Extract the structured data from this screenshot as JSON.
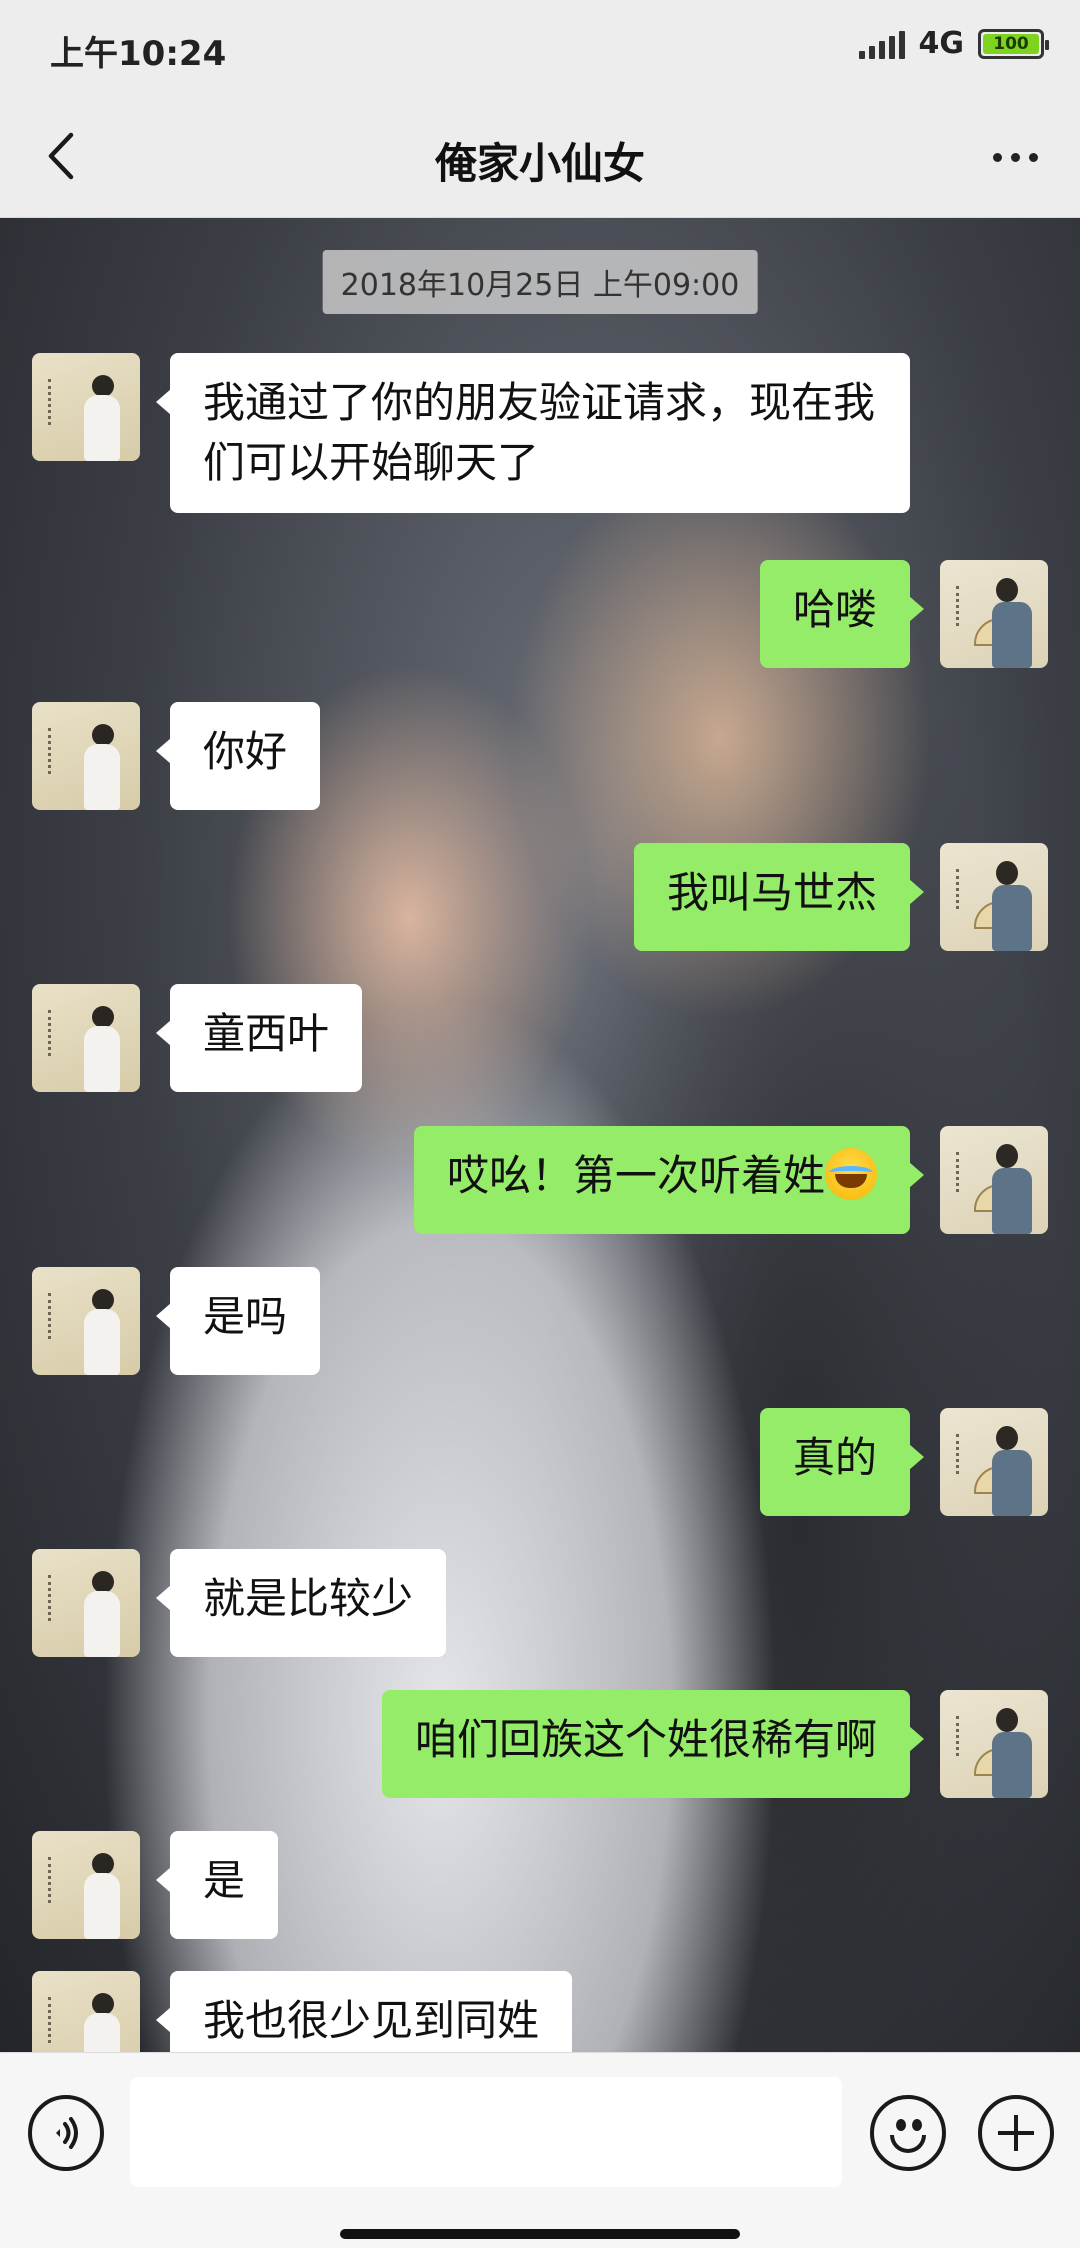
{
  "status_bar": {
    "time": "上午10:24",
    "network": "4G",
    "battery": "100",
    "battery_color": "#7ed321"
  },
  "nav": {
    "title": "俺家小仙女",
    "back_icon": "chevron-left-icon",
    "more_icon": "more-dots-icon"
  },
  "chat": {
    "timestamp": "2018年10月25日 上午09:00",
    "messages": [
      {
        "side": "incoming",
        "text": "我通过了你的朋友验证请求，现在我们可以开始聊天了"
      },
      {
        "side": "outgoing",
        "text": "哈喽"
      },
      {
        "side": "incoming",
        "text": "你好"
      },
      {
        "side": "outgoing",
        "text": "我叫马世杰"
      },
      {
        "side": "incoming",
        "text": "童西叶"
      },
      {
        "side": "outgoing",
        "text": "哎吆！第一次听着姓",
        "emoji": "laughing-tears-emoji"
      },
      {
        "side": "incoming",
        "text": "是吗"
      },
      {
        "side": "outgoing",
        "text": "真的"
      },
      {
        "side": "incoming",
        "text": "就是比较少"
      },
      {
        "side": "outgoing",
        "text": "咱们回族这个姓很稀有啊"
      },
      {
        "side": "incoming",
        "text": "是"
      },
      {
        "side": "incoming",
        "text": "我也很少见到同姓"
      }
    ]
  },
  "input_bar": {
    "voice_icon": "voice-icon",
    "emoji_icon": "smiley-icon",
    "add_icon": "plus-icon",
    "input_value": ""
  },
  "colors": {
    "outgoing_bubble": "#95ec69",
    "incoming_bubble": "#ffffff",
    "bar_background": "#ededed"
  }
}
